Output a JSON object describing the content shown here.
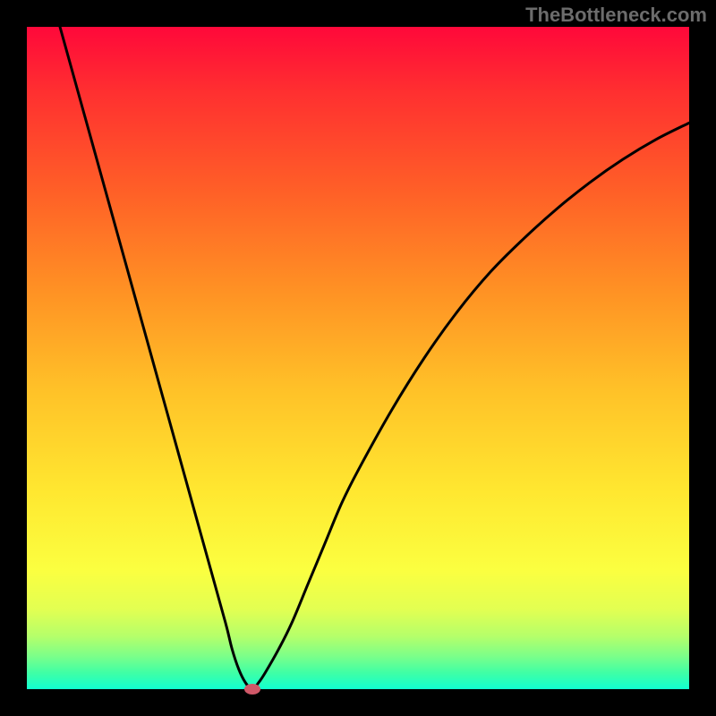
{
  "watermark": "TheBottleneck.com",
  "colors": {
    "frame": "#000000",
    "gradient_top": "#ff083a",
    "gradient_bottom": "#11ffd0",
    "curve": "#000000",
    "marker": "#d05868"
  },
  "chart_data": {
    "type": "line",
    "title": "",
    "xlabel": "",
    "ylabel": "",
    "xlim": [
      0,
      100
    ],
    "ylim": [
      0,
      100
    ],
    "grid": false,
    "legend": false,
    "annotations": [],
    "series": [
      {
        "name": "bottleneck-curve",
        "x": [
          5,
          7.5,
          10,
          12.5,
          15,
          17.5,
          20,
          22.5,
          25,
          27.5,
          30,
          31,
          32,
          33,
          34,
          35,
          36,
          38,
          40,
          42.5,
          45,
          47.5,
          50,
          55,
          60,
          65,
          70,
          75,
          80,
          85,
          90,
          95,
          100
        ],
        "y": [
          100,
          91,
          82,
          73,
          64,
          55,
          46,
          37,
          28,
          19,
          10,
          6,
          3,
          1,
          0,
          1,
          2.5,
          6,
          10,
          16,
          22,
          28,
          33,
          42,
          50,
          57,
          63,
          68,
          72.5,
          76.5,
          80,
          83,
          85.5
        ]
      }
    ],
    "marker": {
      "x": 34,
      "y": 0
    }
  }
}
